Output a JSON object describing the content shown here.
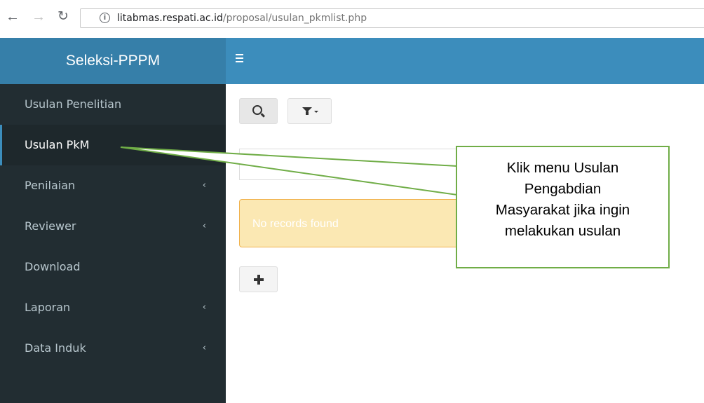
{
  "browser": {
    "url_host": "litabmas.respati.ac.id",
    "url_path": "/proposal/usulan_pkmlist.php",
    "back_icon": "arrow-left",
    "forward_icon": "arrow-right",
    "reload_icon": "reload"
  },
  "header": {
    "brand": "Seleksi-PPPM",
    "toggle_icon": "hamburger-menu"
  },
  "sidebar": {
    "items": [
      {
        "label": "Usulan Penelitian",
        "has_submenu": false
      },
      {
        "label": "Usulan PkM",
        "active": true,
        "has_submenu": false
      },
      {
        "label": "Penilaian",
        "has_submenu": true
      },
      {
        "label": "Reviewer",
        "has_submenu": true
      },
      {
        "label": "Download",
        "has_submenu": false
      },
      {
        "label": "Laporan",
        "has_submenu": true
      },
      {
        "label": "Data Induk",
        "has_submenu": true
      }
    ],
    "chevron_glyph": "‹"
  },
  "content": {
    "search_icon": "magnifier",
    "filter_icon": "funnel-dropdown",
    "add_icon": "plus",
    "empty_message": "No records found"
  },
  "callout": {
    "lines": [
      "Klik menu Usulan",
      "Pengabdian",
      "Masyarakat jika ingin",
      "melakukan usulan"
    ]
  },
  "colors": {
    "header_brand": "#367fa9",
    "header_bar": "#3c8dbc",
    "sidebar": "#222d32",
    "sidebar_active": "#1e282c",
    "alert_bg": "#fbe8b3",
    "callout_border": "#70ad47"
  }
}
